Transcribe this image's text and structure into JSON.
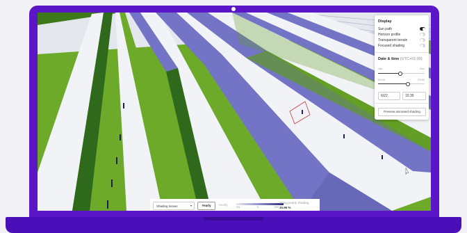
{
  "panel": {
    "display_title": "Display",
    "toggles": [
      {
        "label": "Sun path",
        "on": true
      },
      {
        "label": "Horizon profile",
        "on": false
      },
      {
        "label": "Transparent terrain",
        "on": false
      },
      {
        "label": "Focused shading",
        "on": false
      }
    ],
    "datetime_title": "Date & time",
    "timezone": "(UTC+01:00)",
    "month_start": "Jan",
    "month_end": "Dec",
    "month_fraction": 0.47,
    "time_start": "00:00",
    "time_end": "23:59",
    "time_fraction": 0.62,
    "date_value": "6/22",
    "time_value": "15:35",
    "preview_label": "Preview animated shading"
  },
  "toolbar": {
    "mode_select": "Shading losses",
    "mode_chevron": "▾",
    "yearly_label": "Yearly",
    "hourly_label": "Hourly",
    "legend_ticks": [
      "0%",
      "5",
      "10%"
    ],
    "stat_label": "String yearly shading",
    "stat_value": "10.96 %"
  },
  "colors": {
    "frame": "#5b16c8",
    "grass": "#6eaa2a",
    "panel_blue": "#7474c6",
    "panel_white": "#f2f3f6",
    "sky": "#cfd6ec"
  }
}
